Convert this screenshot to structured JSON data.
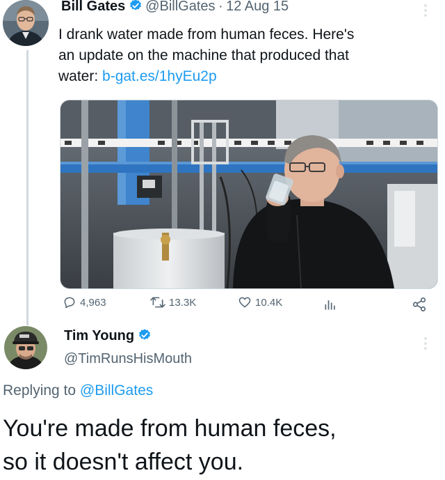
{
  "tweet": {
    "author_name": "Bill Gates",
    "author_handle": "@BillGates",
    "separator": "·",
    "date": "12 Aug 15",
    "text_line1": "I drank water made from human feces. Here's",
    "text_line2": "an update on the machine that produced that",
    "text_line3_prefix": "water: ",
    "link_text": "b-gat.es/1hyEu2p",
    "stats": {
      "replies": "4,963",
      "retweets": "13.3K",
      "likes": "10.4K"
    }
  },
  "reply": {
    "author_name": "Tim Young",
    "author_handle": "@TimRunsHisMouth",
    "replying_to_prefix": "Replying to ",
    "replying_to_handle": "@BillGates",
    "text_line1": "You're made from human feces,",
    "text_line2": "so it doesn't affect you."
  },
  "colors": {
    "link": "#1d9bf0",
    "secondary_text": "#536471",
    "verified_badge": "#1d9bf0"
  },
  "icons": [
    "reply-icon",
    "retweet-icon",
    "like-icon",
    "views-icon",
    "share-icon",
    "verified-badge-icon",
    "more-options-icon"
  ]
}
